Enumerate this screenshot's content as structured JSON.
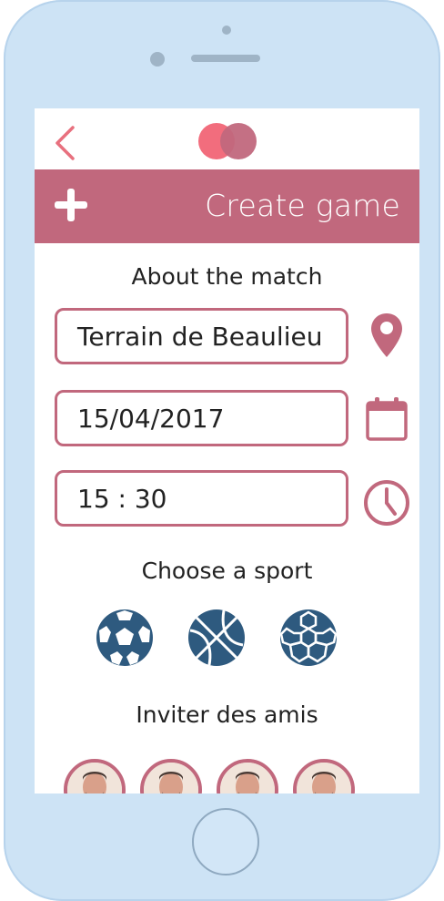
{
  "header": {
    "title": "Create game"
  },
  "about": {
    "title": "About the match",
    "location_value": "Terrain de Beaulieu",
    "date_value": "15/04/2017",
    "time_value": "15 : 30"
  },
  "sport": {
    "title": "Choose a sport",
    "options": [
      "soccer-ball-icon",
      "basketball-icon",
      "handball-icon"
    ]
  },
  "friends": {
    "title": "Inviter des amis",
    "count_visible": 4
  },
  "colors": {
    "accent": "#c1687d",
    "logo_left": "#f26d7d",
    "logo_right": "#c1687d",
    "sport_icon": "#2e5a7f",
    "device": "#cde3f5"
  },
  "icons": {
    "back": "chevron-left-icon",
    "add": "plus-icon",
    "location": "map-pin-icon",
    "date": "calendar-icon",
    "time": "clock-icon"
  }
}
